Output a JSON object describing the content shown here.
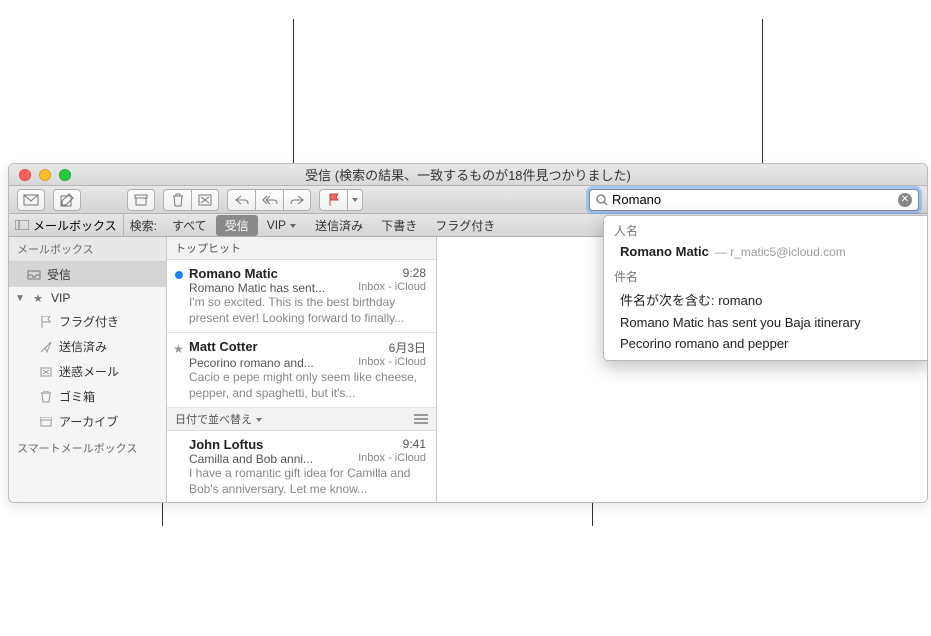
{
  "window": {
    "title": "受信 (検索の結果、一致するものが18件見つかりました)"
  },
  "search": {
    "value": "Romano"
  },
  "scope": {
    "mailboxes_label": "メールボックス",
    "search_label": "検索:",
    "all": "すべて",
    "inbox": "受信",
    "vip": "VIP",
    "sent": "送信済み",
    "drafts": "下書き",
    "flagged": "フラグ付き"
  },
  "sidebar": {
    "header": "メールボックス",
    "items": [
      {
        "label": "受信",
        "icon": "inbox"
      },
      {
        "label": "VIP",
        "icon": "star",
        "expanded": true
      },
      {
        "label": "フラグ付き",
        "icon": "flag",
        "child": true
      },
      {
        "label": "送信済み",
        "icon": "sent",
        "child": true
      },
      {
        "label": "迷惑メール",
        "icon": "junk",
        "child": true
      },
      {
        "label": "ゴミ箱",
        "icon": "trash",
        "child": true
      },
      {
        "label": "アーカイブ",
        "icon": "archive",
        "child": true
      }
    ],
    "smart_label": "スマートメールボックス"
  },
  "msglist": {
    "top_hits_label": "トップヒット",
    "sort_label": "日付で並べ替え",
    "sections": [
      {
        "kind": "top",
        "items": [
          {
            "from": "Romano Matic",
            "time": "9:28",
            "subject": "Romano Matic has sent...",
            "folder": "Inbox - iCloud",
            "preview": "I'm so excited. This is the best birthday present ever! Looking forward to finally...",
            "unread": true
          },
          {
            "from": "Matt Cotter",
            "time": "6月3日",
            "subject": "Pecorino romano and...",
            "folder": "Inbox - iCloud",
            "preview": "Cacio e pepe might only seem like cheese, pepper, and spaghetti, but it's...",
            "star": true
          }
        ]
      },
      {
        "kind": "rest",
        "items": [
          {
            "from": "John Loftus",
            "time": "9:41",
            "subject": "Camilla and Bob anni...",
            "folder": "Inbox - iCloud",
            "preview": "I have a romantic gift idea for Camilla and Bob's anniversary. Let me know..."
          }
        ]
      }
    ]
  },
  "suggestions": {
    "people_header": "人名",
    "person_name": "Romano Matic",
    "person_email": "r_matic5@icloud.com",
    "subject_header": "件名",
    "subject_contains": "件名が次を含む: romano",
    "subj1": "Romano Matic has sent you Baja itinerary",
    "subj2": "Pecorino romano and pepper"
  }
}
